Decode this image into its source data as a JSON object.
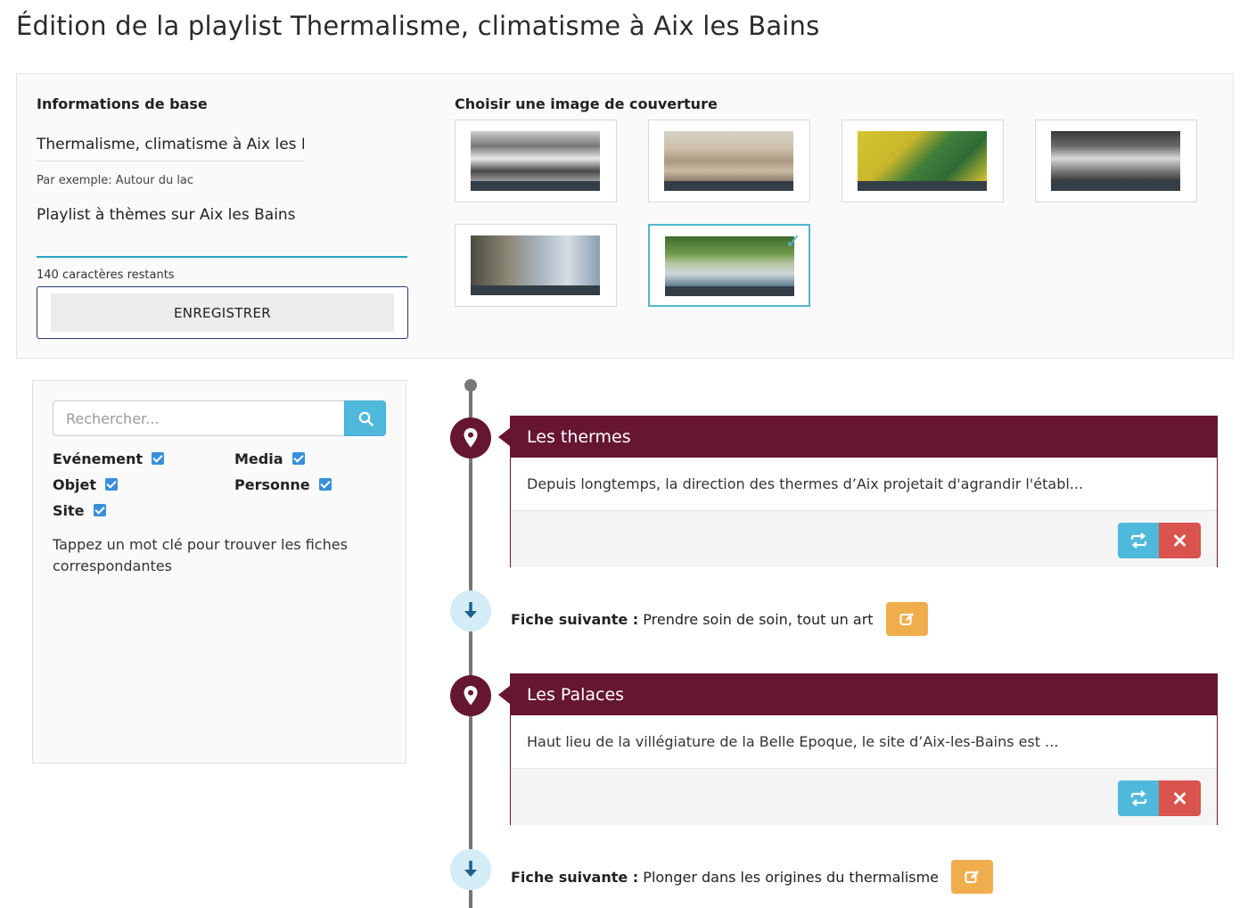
{
  "page": {
    "title": "Édition de la playlist Thermalisme, climatisme à Aix les Bains"
  },
  "base_info": {
    "heading": "Informations de base",
    "title_value": "Thermalisme, climatisme à Aix les Bains",
    "title_hint": "Par exemple: Autour du lac",
    "description_value": "Playlist à thèmes sur Aix les Bains",
    "remaining": "140 caractères restants",
    "save_label": "ENREGISTRER"
  },
  "cover": {
    "heading": "Choisir une image de couverture",
    "selected_index": 6,
    "check_glyph": "✓"
  },
  "search": {
    "placeholder": "Rechercher...",
    "filters": [
      {
        "label": "Evénement",
        "checked": true
      },
      {
        "label": "Media",
        "checked": true
      },
      {
        "label": "Objet",
        "checked": true
      },
      {
        "label": "Personne",
        "checked": true
      },
      {
        "label": "Site",
        "checked": true
      }
    ],
    "help_text": "Tappez un mot clé pour trouver les fiches correspondantes"
  },
  "timeline": {
    "items": [
      {
        "title": "Les thermes",
        "excerpt": "Depuis longtemps, la direction des thermes d’Aix projetait d'agrandir l'établ..."
      },
      {
        "title": "Les Palaces",
        "excerpt": "Haut lieu de la villégiature de la Belle Epoque, le site d’Aix-les-Bains est ..."
      }
    ],
    "next_label": "Fiche suivante :",
    "next": [
      {
        "text": "Prendre soin de soin, tout un art"
      },
      {
        "text": "Plonger dans les origines du thermalisme"
      }
    ]
  },
  "colors": {
    "accent": "#27a5bd",
    "card_header": "#661533",
    "refresh": "#4fb9dc",
    "delete": "#d9534f",
    "edit": "#f0ad4e"
  },
  "icons": {
    "search": "search-icon",
    "pin": "map-pin-icon",
    "down": "arrow-down-icon",
    "refresh": "refresh-icon",
    "delete": "close-icon",
    "edit": "edit-icon"
  }
}
